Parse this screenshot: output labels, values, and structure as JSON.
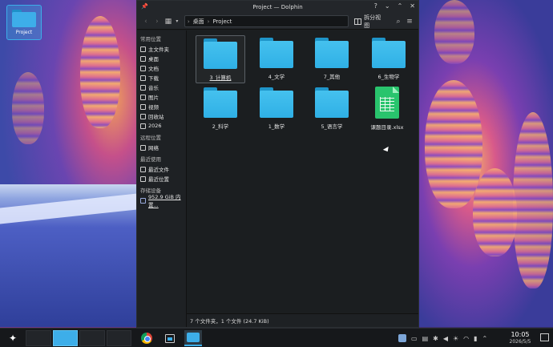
{
  "desktop": {
    "icon_label": "Project"
  },
  "window": {
    "title": "Project — Dolphin",
    "breadcrumb": [
      "桌面",
      "Project"
    ],
    "split_label": "拆分视图",
    "sidebar": {
      "sections": [
        {
          "heading": "常用位置",
          "items": [
            "主文件夹",
            "桌面",
            "文档",
            "下载",
            "音乐",
            "图片",
            "视频",
            "回收站",
            "2026"
          ]
        },
        {
          "heading": "远程位置",
          "items": [
            "网络"
          ]
        },
        {
          "heading": "最近使用",
          "items": [
            "最近文件",
            "最近位置"
          ]
        },
        {
          "heading": "存储设备",
          "items": [
            "952.9 GiB 内置..."
          ]
        }
      ]
    },
    "files": [
      {
        "name": "3_计算机",
        "type": "folder",
        "selected": true
      },
      {
        "name": "4_文学",
        "type": "folder"
      },
      {
        "name": "7_其他",
        "type": "folder"
      },
      {
        "name": "6_生物学",
        "type": "folder"
      },
      {
        "name": "2_科学",
        "type": "folder"
      },
      {
        "name": "1_数学",
        "type": "folder"
      },
      {
        "name": "5_语言学",
        "type": "folder"
      },
      {
        "name": "课题目录.xlsx",
        "type": "spreadsheet"
      }
    ],
    "status": "7 个文件夹，1 个文件 (24.7 KiB)"
  },
  "taskbar": {
    "time": "10:05",
    "date": "2026/5/5",
    "accent": "#3daee9"
  }
}
